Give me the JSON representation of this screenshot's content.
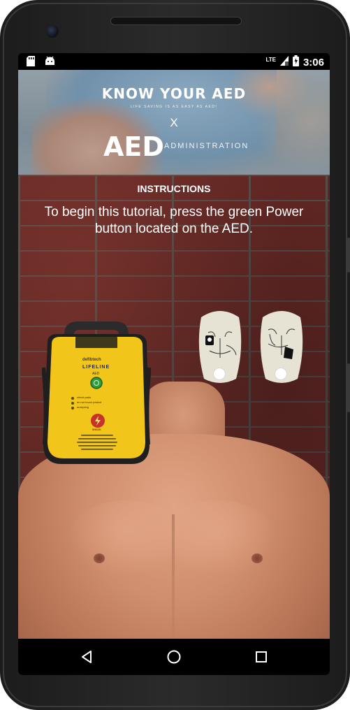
{
  "status_bar": {
    "time": "3:06",
    "network": "LTE",
    "icons": [
      "sd-card-icon",
      "android-icon",
      "signal-icon",
      "battery-icon"
    ]
  },
  "banner": {
    "title": "KNOW YOUR AED",
    "subtitle": "LIFE SAVING IS AS EASY AS AED!",
    "separator": "X",
    "aed": "AED",
    "administration": "ADMINISTRATION"
  },
  "instructions": {
    "label": "INSTRUCTIONS",
    "text": "To begin this tutorial, press the green Power button located on the AED."
  },
  "aed_device": {
    "brand": "defibtech",
    "model_top": "LIFE",
    "model_bottom": "LINE",
    "model_sub": "AED",
    "status_lines": [
      "check pads",
      "do not touch patient",
      "analyzing"
    ],
    "shock_label": "SHOCK",
    "body_color": "#f2c51a",
    "power_button_color": "#2e9c3a"
  },
  "pads": {
    "left_pad_label": "pad-placement-option-1",
    "right_pad_label": "pad-placement-option-2"
  },
  "navigation": {
    "icons": [
      "back-icon",
      "home-icon",
      "recents-icon"
    ]
  },
  "colors": {
    "brick": "#6b2a26",
    "mortar": "#5a5652",
    "aed_yellow": "#f2c51a"
  }
}
